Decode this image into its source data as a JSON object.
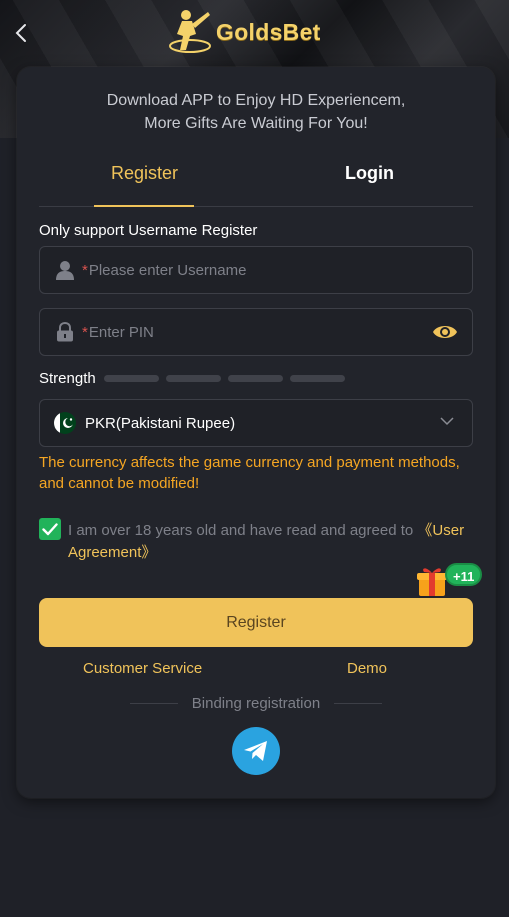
{
  "header": {
    "back_icon": "chevron-left-icon",
    "logo_text": "GoldsBet"
  },
  "promo": {
    "line1": "Download APP to Enjoy HD Experiencem,",
    "line2": "More Gifts Are Waiting For You!"
  },
  "tabs": {
    "register": "Register",
    "login": "Login",
    "active": "register"
  },
  "form": {
    "section_label": "Only support Username Register",
    "username": {
      "required_mark": "*",
      "placeholder": "Please enter Username",
      "value": ""
    },
    "pin": {
      "required_mark": "*",
      "placeholder": "Enter PIN",
      "value": ""
    },
    "strength_label": "Strength",
    "strength_level": 0,
    "currency": {
      "value": "PKR(Pakistani Rupee)",
      "flag_icon": "pakistan-flag-icon"
    },
    "currency_warning": "The currency affects the game currency and payment methods, and cannot be modified!",
    "agreement": {
      "checked": true,
      "text": "I am over 18 years old and have read and agreed to ",
      "link": "《User Agreement》"
    },
    "gift_badge": "+11",
    "register_button": "Register"
  },
  "links": {
    "customer_service": "Customer Service",
    "demo": "Demo"
  },
  "binding": {
    "label": "Binding registration",
    "telegram_icon": "telegram-icon"
  },
  "colors": {
    "accent": "#f0c35a",
    "warning": "#f5a623",
    "success": "#21b35a",
    "required": "#d9534f",
    "telegram": "#2aa3e0"
  }
}
